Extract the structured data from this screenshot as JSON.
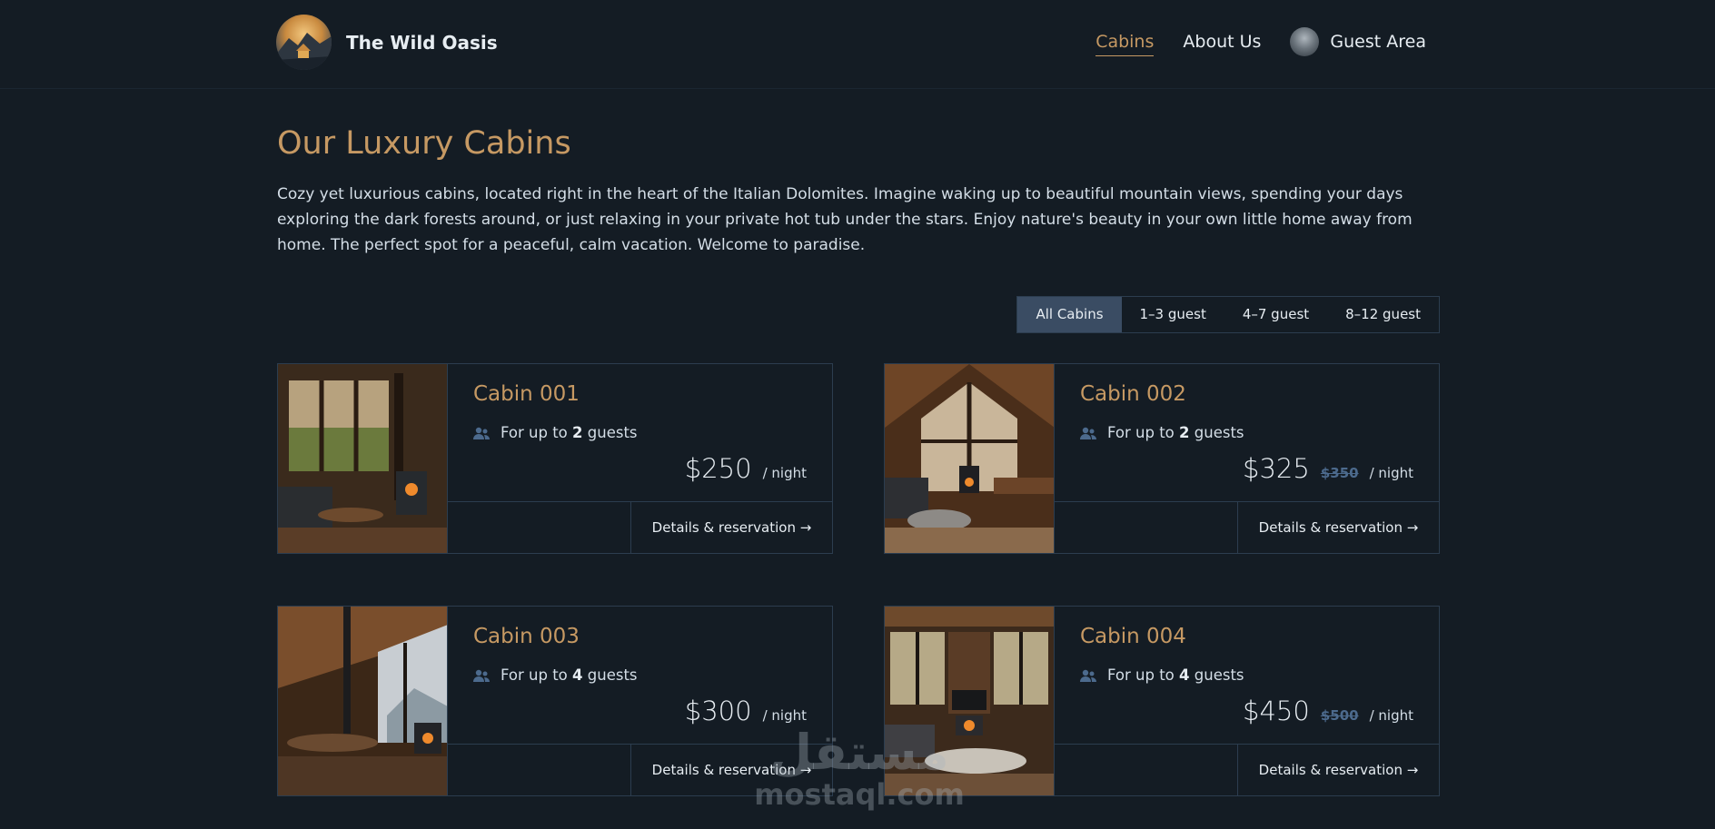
{
  "header": {
    "logo_name": "The Wild Oasis",
    "nav": [
      {
        "label": "Cabins",
        "active": true
      },
      {
        "label": "About Us",
        "active": false
      }
    ],
    "guest_label": "Guest Area"
  },
  "main": {
    "title": "Our Luxury Cabins",
    "intro": "Cozy yet luxurious cabins, located right in the heart of the Italian Dolomites. Imagine waking up to beautiful mountain views, spending your days exploring the dark forests around, or just relaxing in your private hot tub under the stars. Enjoy nature's beauty in your own little home away from home. The perfect spot for a peaceful, calm vacation. Welcome to paradise.",
    "filters": [
      "All Cabins",
      "1–3 guest",
      "4–7 guest",
      "8–12 guest"
    ],
    "active_filter": "All Cabins"
  },
  "cabins": [
    {
      "name": "Cabin 001",
      "capacity_prefix": "For up to",
      "capacity": "2",
      "capacity_suffix": "guests",
      "price": "$250",
      "old_price": "",
      "per": "/ night",
      "action": "Details & reservation →"
    },
    {
      "name": "Cabin 002",
      "capacity_prefix": "For up to",
      "capacity": "2",
      "capacity_suffix": "guests",
      "price": "$325",
      "old_price": "$350",
      "per": "/ night",
      "action": "Details & reservation →"
    },
    {
      "name": "Cabin 003",
      "capacity_prefix": "For up to",
      "capacity": "4",
      "capacity_suffix": "guests",
      "price": "$300",
      "old_price": "",
      "per": "/ night",
      "action": "Details & reservation →"
    },
    {
      "name": "Cabin 004",
      "capacity_prefix": "For up to",
      "capacity": "4",
      "capacity_suffix": "guests",
      "price": "$450",
      "old_price": "$500",
      "per": "/ night",
      "action": "Details & reservation →"
    }
  ],
  "watermark": {
    "arabic": "مستقل",
    "latin": "mostaql.com"
  },
  "colors": {
    "background": "#141c24",
    "accent": "#c69963",
    "border": "#2c3d4f",
    "active_filter": "#3a4c63",
    "discount": "#4c6a8d"
  }
}
